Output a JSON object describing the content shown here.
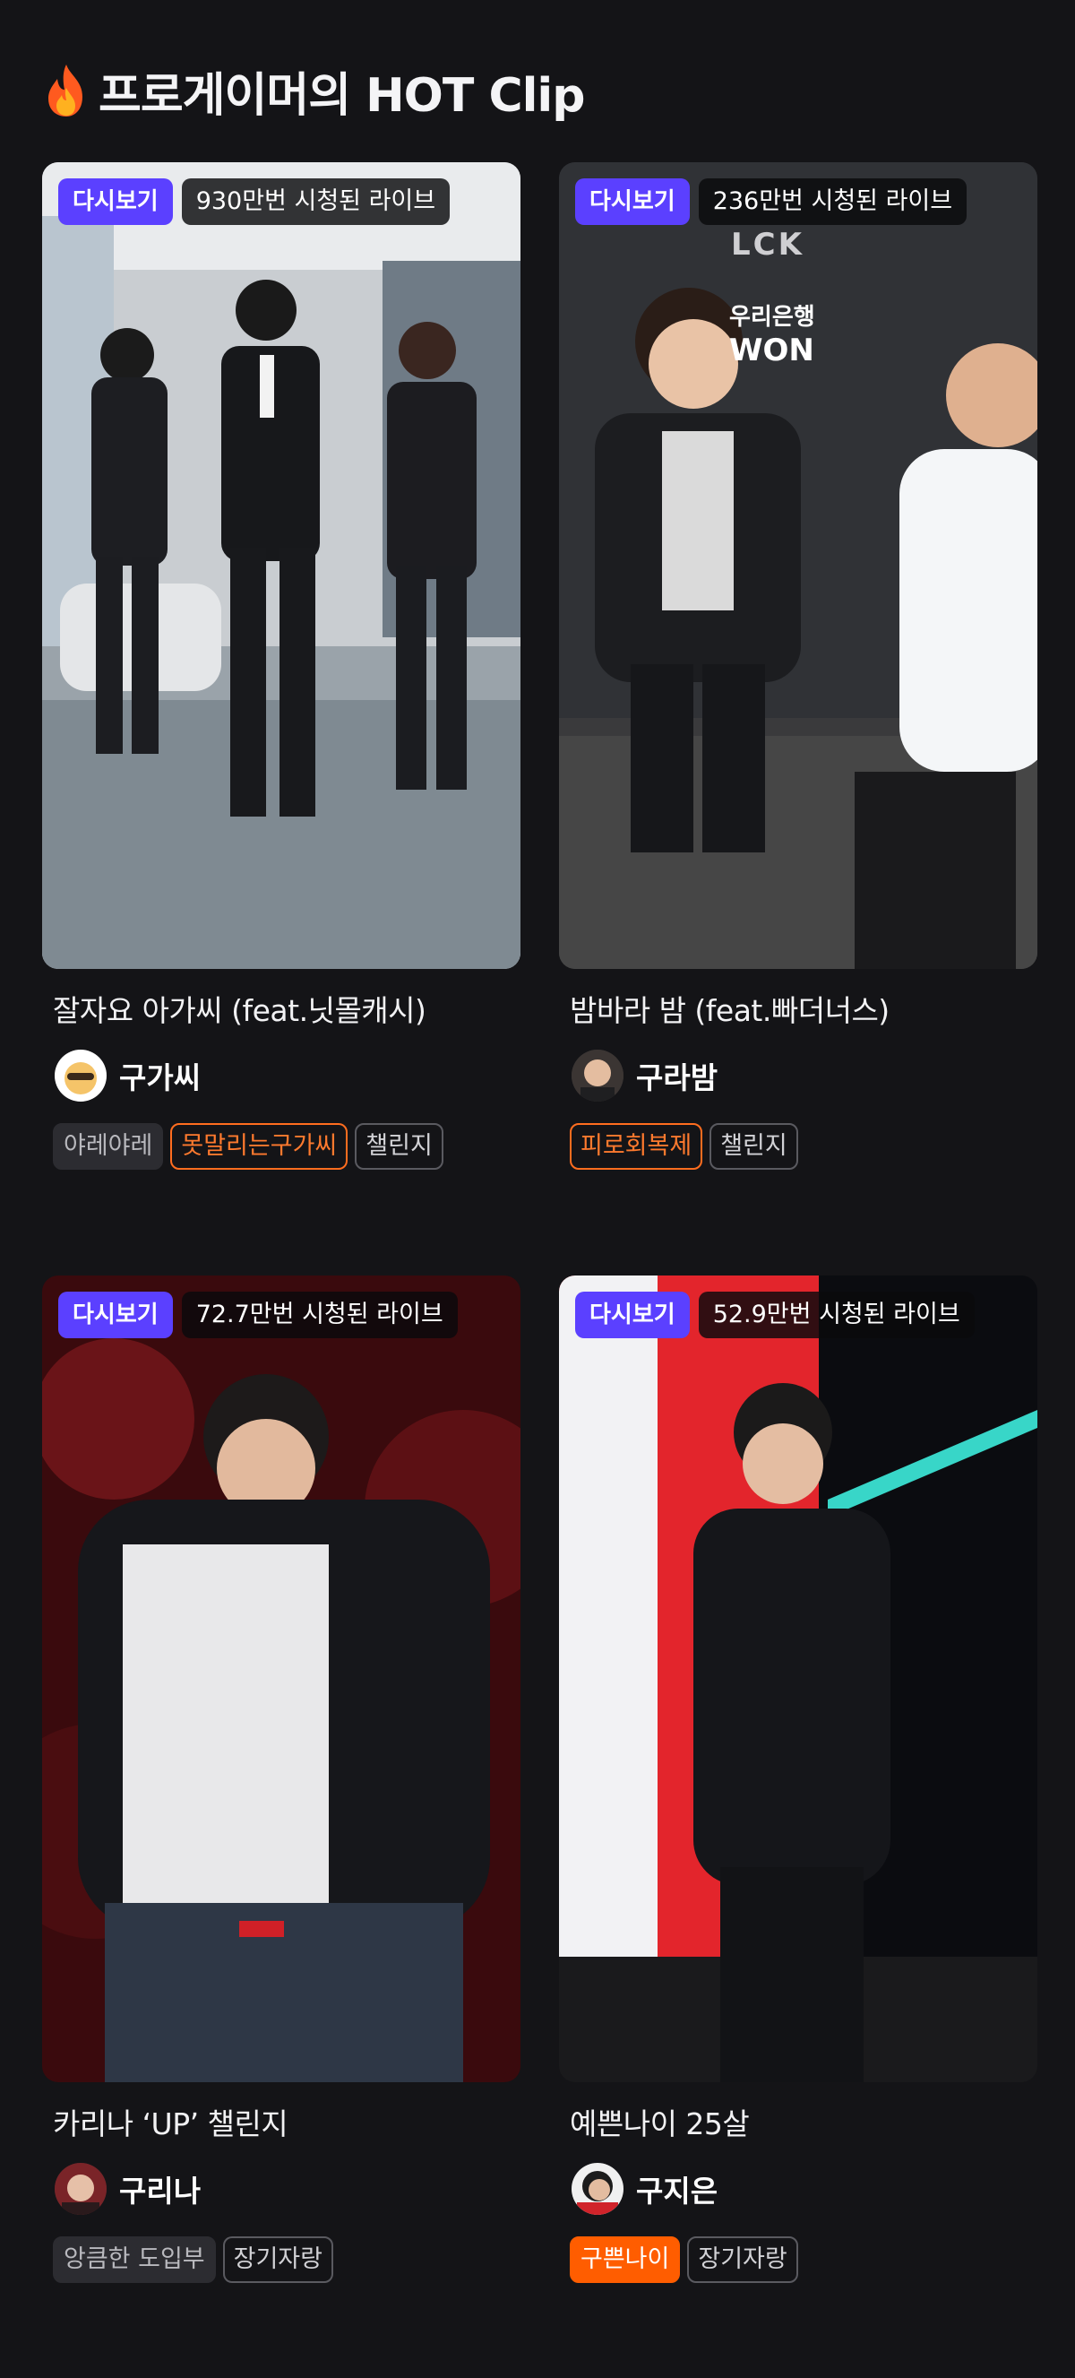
{
  "section": {
    "title": "프로게이머의 HOT Clip",
    "icon": "fire-icon"
  },
  "clips": [
    {
      "badge": "다시보기",
      "views": "930만번 시청된 라이브",
      "title": "잘자요 아가씨 (feat.닛몰캐시)",
      "streamer": "구가씨",
      "tags": [
        {
          "label": "야레야레",
          "style": "plain"
        },
        {
          "label": "못말리는구가씨",
          "style": "orange-outline"
        },
        {
          "label": "챌린지",
          "style": "outline"
        }
      ]
    },
    {
      "badge": "다시보기",
      "views": "236만번 시청된 라이브",
      "title": "밤바라 밤 (feat.빠더너스)",
      "streamer": "구라밤",
      "tags": [
        {
          "label": "피로회복제",
          "style": "orange-outline"
        },
        {
          "label": "챌린지",
          "style": "outline"
        }
      ],
      "overlay_text": {
        "top": "LCK",
        "sponsor1": "우리은행",
        "sponsor2": "WON"
      }
    },
    {
      "badge": "다시보기",
      "views": "72.7만번 시청된 라이브",
      "title": "카리나 ‘UP’ 챌린지",
      "streamer": "구리나",
      "tags": [
        {
          "label": "앙큼한 도입부",
          "style": "plain"
        },
        {
          "label": "장기자랑",
          "style": "outline"
        }
      ]
    },
    {
      "badge": "다시보기",
      "views": "52.9만번 시청된 라이브",
      "title": "예쁜나이 25살",
      "streamer": "구지은",
      "tags": [
        {
          "label": "구쁜나이",
          "style": "orange-solid"
        },
        {
          "label": "장기자랑",
          "style": "outline"
        }
      ]
    }
  ],
  "colors": {
    "background": "#141417",
    "replay_badge": "#5b40ff",
    "accent_orange": "#ff6d1f"
  }
}
